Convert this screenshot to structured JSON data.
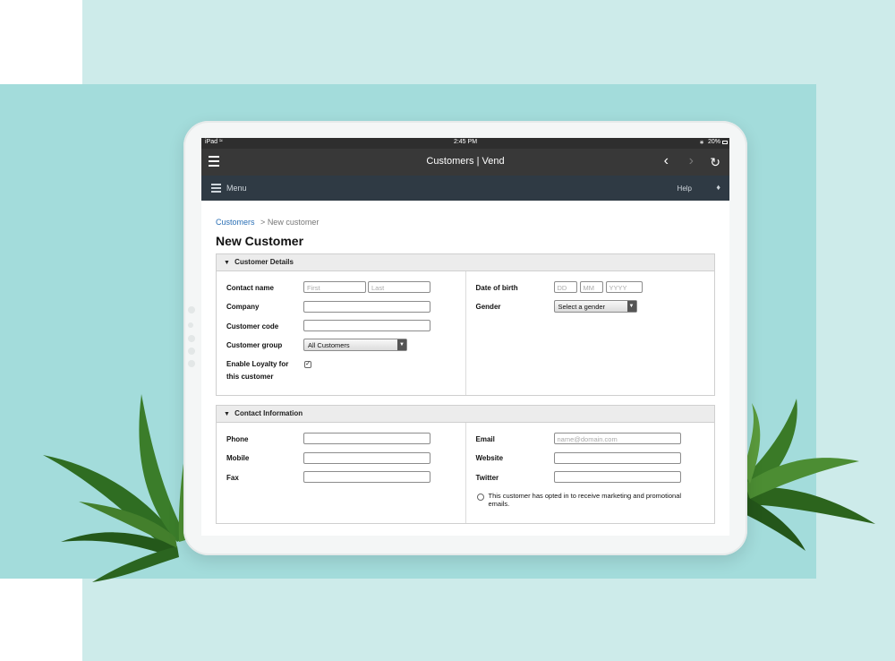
{
  "status_bar": {
    "device": "iPad",
    "time": "2:45 PM",
    "battery": "20%"
  },
  "navbar": {
    "title": "Customers | Vend"
  },
  "menubar": {
    "menu_label": "Menu",
    "help_label": "Help"
  },
  "breadcrumb": {
    "parent": "Customers",
    "separator": ">",
    "current": "New customer"
  },
  "page_title": "New Customer",
  "customer_details": {
    "heading": "Customer Details",
    "contact_name": {
      "label": "Contact name",
      "first_placeholder": "First",
      "last_placeholder": "Last"
    },
    "company": {
      "label": "Company",
      "value": ""
    },
    "customer_code": {
      "label": "Customer code",
      "value": ""
    },
    "customer_group": {
      "label": "Customer group",
      "value": "All Customers"
    },
    "loyalty": {
      "label_line1": "Enable Loyalty for",
      "label_line2": "this customer",
      "checked": true
    },
    "date_of_birth": {
      "label": "Date of birth",
      "dd": "DD",
      "mm": "MM",
      "yyyy": "YYYY"
    },
    "gender": {
      "label": "Gender",
      "value": "Select a gender"
    }
  },
  "contact_information": {
    "heading": "Contact Information",
    "phone": {
      "label": "Phone",
      "value": ""
    },
    "mobile": {
      "label": "Mobile",
      "value": ""
    },
    "fax": {
      "label": "Fax",
      "value": ""
    },
    "email": {
      "label": "Email",
      "placeholder": "name@domain.com"
    },
    "website": {
      "label": "Website",
      "value": ""
    },
    "twitter": {
      "label": "Twitter",
      "value": ""
    },
    "marketing_optin": {
      "text": "This customer has opted in to receive marketing and promotional emails.",
      "checked": false
    }
  }
}
